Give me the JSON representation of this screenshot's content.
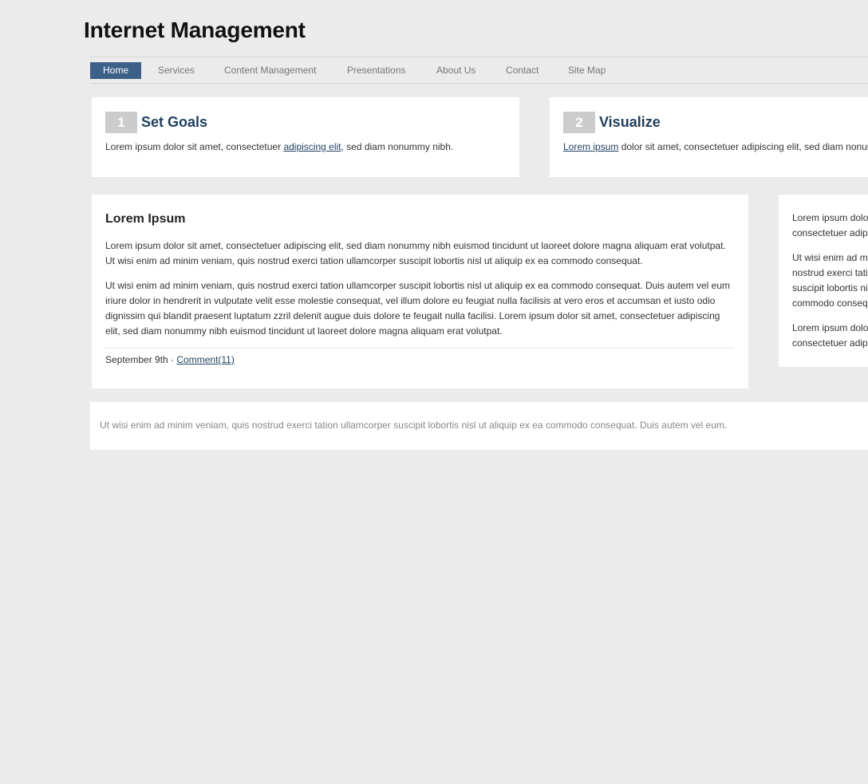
{
  "site": {
    "title": "Internet Management"
  },
  "nav": {
    "items": [
      {
        "label": "Home",
        "active": true
      },
      {
        "label": "Services"
      },
      {
        "label": "Content Management"
      },
      {
        "label": "Presentations"
      },
      {
        "label": "About Us"
      },
      {
        "label": "Contact"
      },
      {
        "label": "Site Map"
      }
    ]
  },
  "steps": [
    {
      "number": "1",
      "title": "Set Goals",
      "text_before": "Lorem ipsum dolor sit amet, consectetuer ",
      "link": "adipiscing elit",
      "text_after": ", sed diam nonummy nibh."
    },
    {
      "number": "2",
      "title": "Visualize",
      "link": "Lorem ipsum",
      "text_after": " dolor sit amet, consectetuer adipiscing elit, sed diam nonummy nibh."
    }
  ],
  "post": {
    "title": "Lorem Ipsum",
    "paragraphs": [
      "Lorem ipsum dolor sit amet, consectetuer adipiscing elit, sed diam nonummy nibh euismod tincidunt ut laoreet dolore magna aliquam erat volutpat. Ut wisi enim ad minim veniam, quis nostrud exerci tation ullamcorper suscipit lobortis nisl ut aliquip ex ea commodo consequat.",
      "Ut wisi enim ad minim veniam, quis nostrud exerci tation ullamcorper suscipit lobortis nisl ut aliquip ex ea commodo consequat. Duis autem vel eum iriure dolor in hendrerit in vulputate velit esse molestie consequat, vel illum dolore eu feugiat nulla facilisis at vero eros et accumsan et iusto odio dignissim qui blandit praesent luptatum zzril delenit augue duis dolore te feugait nulla facilisi. Lorem ipsum dolor sit amet, consectetuer adipiscing elit, sed diam nonummy nibh euismod tincidunt ut laoreet dolore magna aliquam erat volutpat."
    ],
    "date": "September 9th",
    "separator": " · ",
    "comments_link": "Comment(11)"
  },
  "sidebar": {
    "paragraphs": [
      "Lorem ipsum dolor sit amet, consectetuer adipiscing elit, sed diam nonummy nibh euismod tincidunt ut laoreet dolore magna aliquam erat volutpat. Ut wisi enim ad minim veniam.",
      "Ut wisi enim ad minim veniam, quis nostrud exerci tation ullamcorper suscipit lobortis nisl ut aliquip ex ea commodo consequat. Duis autem vel eum iriure dolor in hendrerit in vulputate velit esse molestie consequat, vel illum dolore eu feugiat nulla facilisis at vero eros et accumsan et iusto odio dignissim qui blandit praesent luptatum zzril delenit augue duis dolore te feugait nulla facilisi. Lorem ipsum dolor sit amet, consectetuer adipiscing elit.",
      "Lorem ipsum dolor sit amet, consectetuer adipiscing elit, sed diam nonummy nibh euismod tincidunt ut laoreet dolore magna aliquam erat volutpat. Ut wisi enim ad minim veniam."
    ]
  },
  "footer": {
    "text": "Ut wisi enim ad minim veniam, quis nostrud exerci tation ullamcorper suscipit lobortis nisl ut aliquip ex ea commodo consequat. Duis autem vel eum."
  },
  "colors": {
    "background": "#ebebeb",
    "nav_active": "#3d6089",
    "heading": "#1f3f5e",
    "step_badge": "#cccccc"
  }
}
